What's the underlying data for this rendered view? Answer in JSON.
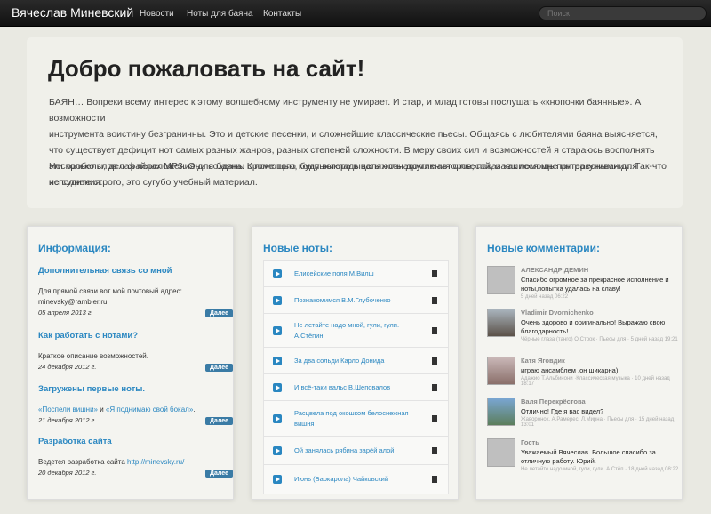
{
  "navbar": {
    "brand": "Вячеслав Миневский",
    "links": [
      "Новости",
      "Ноты для баяна",
      "Контакты"
    ],
    "search_placeholder": "Поиск"
  },
  "hero": {
    "title": "Добро пожаловать на сайт!",
    "p1_lines": [
      "БАЯН… Вопреки всему интерес к этому волшебному инструменту не умирает. И стар, и млад готовы послушать «кнопочки баянные». А возможности",
      "инструмента воистину безграничны. Это и детские песенки, и сложнейшие классические пьесы. Общаясь с любителями баяна выясняется,",
      "что существует дефицит нот самых разных жанров, разных степеней сложности. В меру своих сил и возможностей я стараюсь восполнять",
      "эти пробелы, делая переложения для баяна. Кроме того, буду выкладывать ноты других авторов, показавшиеся мне интересными для исполнения."
    ],
    "p2_lines": [
      "Несколько слов о файлах MP3. Они созданы с помощью компьютера в целях ознакомления с пьесой, и как помощь при разучивании. Так-что",
      "не судите строго, это сугубо учебный материал."
    ]
  },
  "info": {
    "title": "Информация:",
    "more_label": "Далее",
    "items": [
      {
        "title": "Дополнительная связь со мной",
        "text1": "Для прямой связи вот мой почтовый адрес:",
        "text2": "minevsky@rambler.ru",
        "date": "05 апреля 2013 г."
      },
      {
        "title": "Как работать с нотами?",
        "text1": "Краткое описание возможностей.",
        "text2": "",
        "date": "24 декабря 2012 г."
      },
      {
        "title": "Загружены первые ноты.",
        "link1": "«Поспели вишни»",
        "mid": " и ",
        "link2": "«Я поднимаю свой бокал»",
        "end": ".",
        "date": "21 декабря 2012 г."
      },
      {
        "title": "Разработка сайта",
        "text1": "Ведется разработка сайта ",
        "link": "http://minevsky.ru/",
        "date": "20 декабря 2012 г."
      }
    ]
  },
  "notes": {
    "title": "Новые ноты:",
    "items": [
      "Елисейские поля М.Вилш",
      "Познакомимся В.М.Глубоченко",
      "Не летайте надо мной, гули, гули. А.Стёпин",
      "За два сольди Карло Донида",
      "И всё-таки вальс В.Шеповалов",
      "Расцвела под окошком белоснежная вишня",
      "Ой занялась рябина зарёй алой",
      "Июнь (Баркарола) Чайковский"
    ]
  },
  "comments": {
    "title": "Новые комментарии:",
    "items": [
      {
        "author": "АЛЕКСАНДР ДЕМИН",
        "text": "Спасибо огромное за прекрасное исполнение и ноты,попытка удалась на славу!",
        "meta": "5 дней назад 06:22"
      },
      {
        "author": "Vladimir Dvornichenko",
        "text": "Очень здорово и оригинально! Выражаю свою благодарность!",
        "meta": "Чёрные глаза (танго) О.Строк · Пьесы для · 5 дней назад 19:21"
      },
      {
        "author": "Катя Яговдик",
        "text": "играю ансамблем ,он шикарна)",
        "meta": "Адажио Т.Альбинони ·Классическая музыка · 10 дней назад 18:17"
      },
      {
        "author": "Валя Перекрёстова",
        "text": "Отлично! Где я вас видел?",
        "meta": "Жаворонок. А.Рамерес. Л.Мирна · Пьесы для · 15 дней назад 13:01"
      },
      {
        "author": "Гость",
        "text": "Уважаемый Вячеслав. Большое спасибо за отличную работу. Юрий.",
        "meta": "Не летайте надо мной, гули, гули. А.Стёп · 18 дней назад 08:22"
      }
    ]
  }
}
